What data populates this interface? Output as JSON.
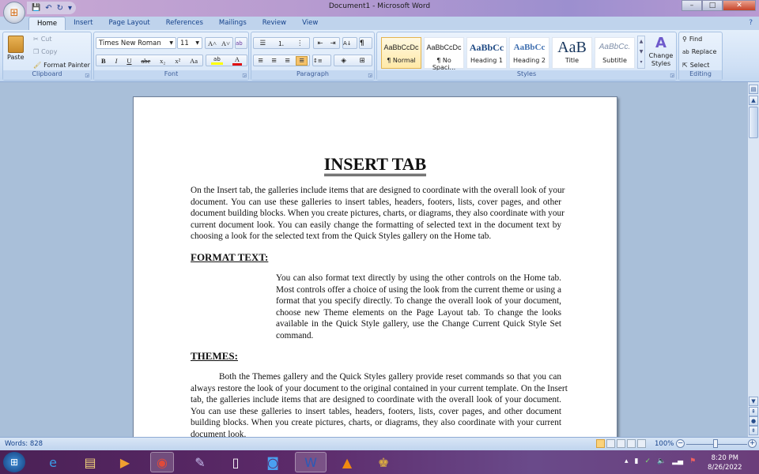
{
  "window": {
    "title": "Document1 - Microsoft Word",
    "minimize": "–",
    "maximize": "□",
    "close": "✕"
  },
  "qat": {
    "save": "💾",
    "undo": "↶",
    "redo": "↻",
    "more": "▾"
  },
  "tabs": [
    "Home",
    "Insert",
    "Page Layout",
    "References",
    "Mailings",
    "Review",
    "View"
  ],
  "active_tab": "Home",
  "ribbon": {
    "clipboard": {
      "label": "Clipboard",
      "paste": "Paste",
      "cut": "Cut",
      "copy": "Copy",
      "format_painter": "Format Painter"
    },
    "font": {
      "label": "Font",
      "font_name": "Times New Roman",
      "font_size": "11",
      "grow": "A˄",
      "shrink": "A˅",
      "clear": "ab",
      "bold": "B",
      "italic": "I",
      "underline": "U",
      "strike": "abe",
      "subscript": "x₂",
      "superscript": "x²",
      "case": "Aa",
      "highlight": "ab",
      "color": "A",
      "font_color": "#e01010",
      "highlight_color": "#ffff00"
    },
    "paragraph": {
      "label": "Paragraph",
      "bullets": "☰",
      "numbering": "⒈",
      "multilevel": "⋮",
      "decrease_indent": "⇤",
      "increase_indent": "⇥",
      "sort": "A↓",
      "show_marks": "¶",
      "align_left": "≡",
      "center": "≡",
      "align_right": "≡",
      "justify": "≡",
      "line_spacing": "↕≡",
      "shading": "◈",
      "borders": "⊞"
    },
    "styles": {
      "label": "Styles",
      "items": [
        {
          "preview": "AaBbCcDc",
          "name": "¶ Normal"
        },
        {
          "preview": "AaBbCcDc",
          "name": "¶ No Spaci..."
        },
        {
          "preview": "AaBbCc",
          "name": "Heading 1"
        },
        {
          "preview": "AaBbCc",
          "name": "Heading 2"
        },
        {
          "preview": "AaB",
          "name": "Title"
        },
        {
          "preview": "AaBbCc.",
          "name": "Subtitle"
        }
      ],
      "selected": "¶ Normal",
      "change_styles": "Change Styles"
    },
    "editing": {
      "label": "Editing",
      "find": "Find",
      "replace": "Replace",
      "select": "Select"
    }
  },
  "document": {
    "title": "INSERT TAB",
    "p1": [
      "On the Insert tab, the galleries include items that are designed to coordinate with the overall look of your",
      "document. You can use these galleries to insert tables, headers, footers, lists, cover pages, and other",
      "document building blocks. When you create pictures, charts, or diagrams, they also coordinate with your",
      "current document look. You can easily change the formatting of selected text in the document text by",
      "choosing a look for the selected text from the Quick Styles gallery on the Home tab."
    ],
    "h2": "FORMAT TEXT:",
    "p2": [
      "You can also format text directly by using the other controls on the Home tab.",
      "Most controls offer a choice of using the look from the current theme or using a",
      "format that you specify directly. To change the overall look of your document,",
      "choose new Theme elements on the Page Layout tab. To change the looks",
      "available in the Quick Style gallery, use the Change Current Quick Style Set",
      "command."
    ],
    "h3": "THEMES:",
    "p3": [
      "Both the Themes gallery and the Quick Styles gallery provide reset commands so that you can",
      "always restore the look of your document to the original contained in your current template. On the Insert",
      "tab, the galleries include items that are designed to coordinate with the overall look of your document.",
      "You can use these galleries to insert tables, headers, footers, lists, cover pages, and other document",
      "building blocks. When you create pictures, charts, or diagrams, they also coordinate with your current",
      "document look."
    ]
  },
  "status": {
    "words": "Words: 828",
    "zoom": "100%",
    "zoom_level_percent": 100
  },
  "taskbar": {
    "time": "8:20 PM",
    "date": "8/26/2022",
    "apps": [
      "start",
      "internet-explorer",
      "file-explorer",
      "media-player",
      "chrome",
      "app",
      "notepad",
      "bluetooth-app",
      "word",
      "vlc",
      "game"
    ],
    "active": "word"
  }
}
